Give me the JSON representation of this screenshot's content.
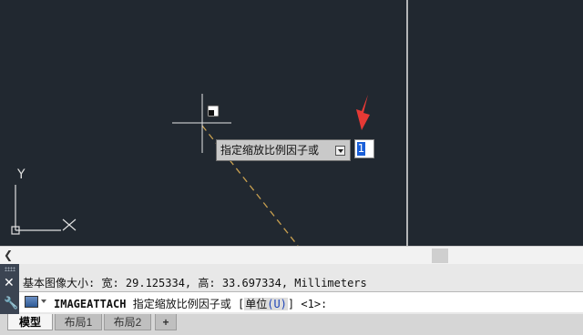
{
  "prompt": {
    "label": "指定缩放比例因子或",
    "input_value": "1"
  },
  "command": {
    "history_line": "基本图像大小: 宽: 29.125334, 高: 33.697334, Millimeters",
    "command_name": "IMAGEATTACH",
    "command_prompt": "指定缩放比例因子或",
    "bracket_open": "[",
    "option_label": "单位",
    "option_key": "(U)",
    "bracket_close": "]",
    "default_value": "<1>:",
    "command_icon": "image-icon"
  },
  "ucs": {
    "y_label": "Y",
    "x_label": "X"
  },
  "tabs": [
    {
      "label": "模型",
      "active": true
    },
    {
      "label": "布局1",
      "active": false
    },
    {
      "label": "布局2",
      "active": false
    },
    {
      "label": "+",
      "active": false
    }
  ],
  "sidebar": {
    "close_icon": "close-icon",
    "settings_icon": "wrench-icon"
  },
  "colors": {
    "canvas": "#212830",
    "crosshair": "#ffffff",
    "dashed_line": "#c8a050",
    "annotation_arrow": "#e53935"
  }
}
